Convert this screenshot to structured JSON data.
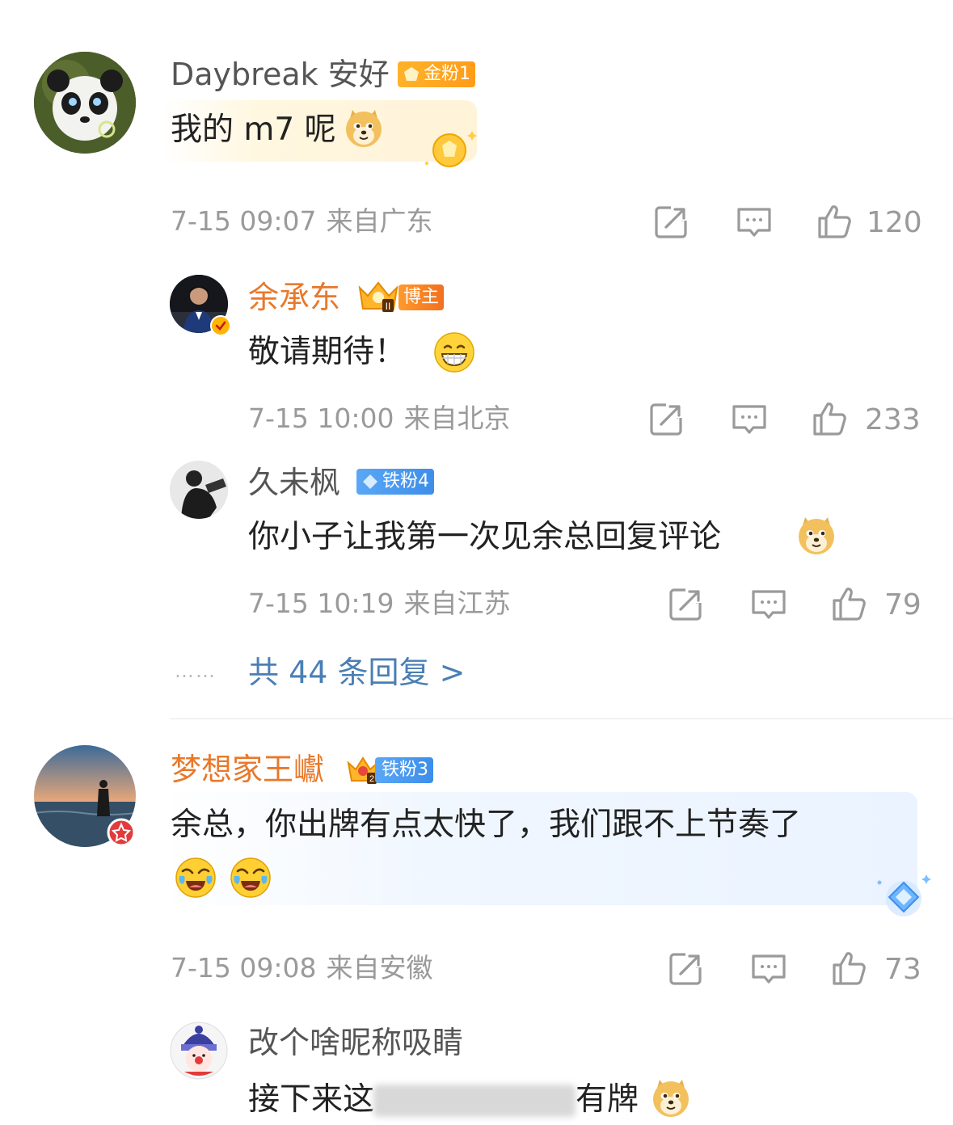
{
  "comments": [
    {
      "username": "Daybreak 安好",
      "badge": "金粉1",
      "text": "我的 m7 呢",
      "time": "7-15 09:07",
      "location": "来自广东",
      "likes": "120"
    },
    {
      "username": "余承东",
      "badge": "博主",
      "text": "敬请期待！",
      "time": "7-15 10:00",
      "location": "来自北京",
      "likes": "233"
    },
    {
      "username": "久未枫",
      "badge": "铁粉4",
      "text": "你小子让我第一次见余总回复评论",
      "time": "7-15 10:19",
      "location": "来自江苏",
      "likes": "79"
    },
    {
      "username": "梦想家王巘",
      "badge": "铁粉3",
      "text_line1": "余总，你出牌有点太快了，我们跟不上节奏了",
      "time": "7-15 09:08",
      "location": "来自安徽",
      "likes": "73"
    },
    {
      "username": "改个啥昵称吸睛",
      "text_visible_start": "接下来这",
      "text_visible_end": "有牌"
    }
  ],
  "replies_link": "共 44 条回复 >",
  "replies_dots": "……",
  "icons": [
    "share-icon",
    "comment-icon",
    "like-icon",
    "doge-emoji",
    "grin-emoji",
    "laugh-cry-emoji",
    "gold-fan-icon",
    "iron-fan-icon",
    "crown-icon",
    "verified-icon"
  ],
  "colors": {
    "accent_link": "#4a7fb5",
    "blogger_name": "#e8792b",
    "meta_gray": "#9a9a9a"
  }
}
